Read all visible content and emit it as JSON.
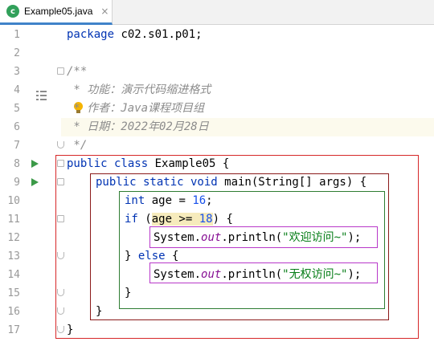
{
  "tab": {
    "label": "Example05.java",
    "icon": "c",
    "close": "×"
  },
  "line_numbers": [
    "1",
    "2",
    "3",
    "4",
    "5",
    "6",
    "7",
    "8",
    "9",
    "10",
    "11",
    "12",
    "13",
    "14",
    "15",
    "16",
    "17"
  ],
  "code": {
    "l1_kw": "package",
    "l1_rest": " c02.s01.p01;",
    "l3": "/**",
    "l4": " * 功能：演示代码缩进格式",
    "l5": " * 作者：Java课程项目组",
    "l6": " * 日期：2022年02月28日",
    "l7": " */",
    "l8_kw": "public class",
    "l8_rest": " Example05 {",
    "l9_kw": "public static void",
    "l9_rest": " main(String[] args) {",
    "l10_kw": "int",
    "l10_rest": " age = ",
    "l10_num": "16",
    "l10_end": ";",
    "l11_kw": "if",
    "l11_open": " (",
    "l11_cond": "age >= ",
    "l11_num": "18",
    "l11_end": ") {",
    "l12_a": "System.",
    "l12_field": "out",
    "l12_b": ".println(",
    "l12_str": "\"欢迎访问~\"",
    "l12_end": ");",
    "l13_a": "} ",
    "l13_kw": "else",
    "l13_b": " {",
    "l14_a": "System.",
    "l14_field": "out",
    "l14_b": ".println(",
    "l14_str": "\"无权访问~\"",
    "l14_end": ");",
    "l15": "}",
    "l16": "}",
    "l17": "}"
  },
  "colors": {
    "keyword": "#0033b3",
    "comment": "#8c8c8c",
    "string": "#067d17",
    "static_field": "#871094",
    "number": "#1750eb",
    "box_class": "#d62728",
    "box_method": "#8b1a1a",
    "box_body": "#2e7d32",
    "box_statement": "#b838c9"
  }
}
